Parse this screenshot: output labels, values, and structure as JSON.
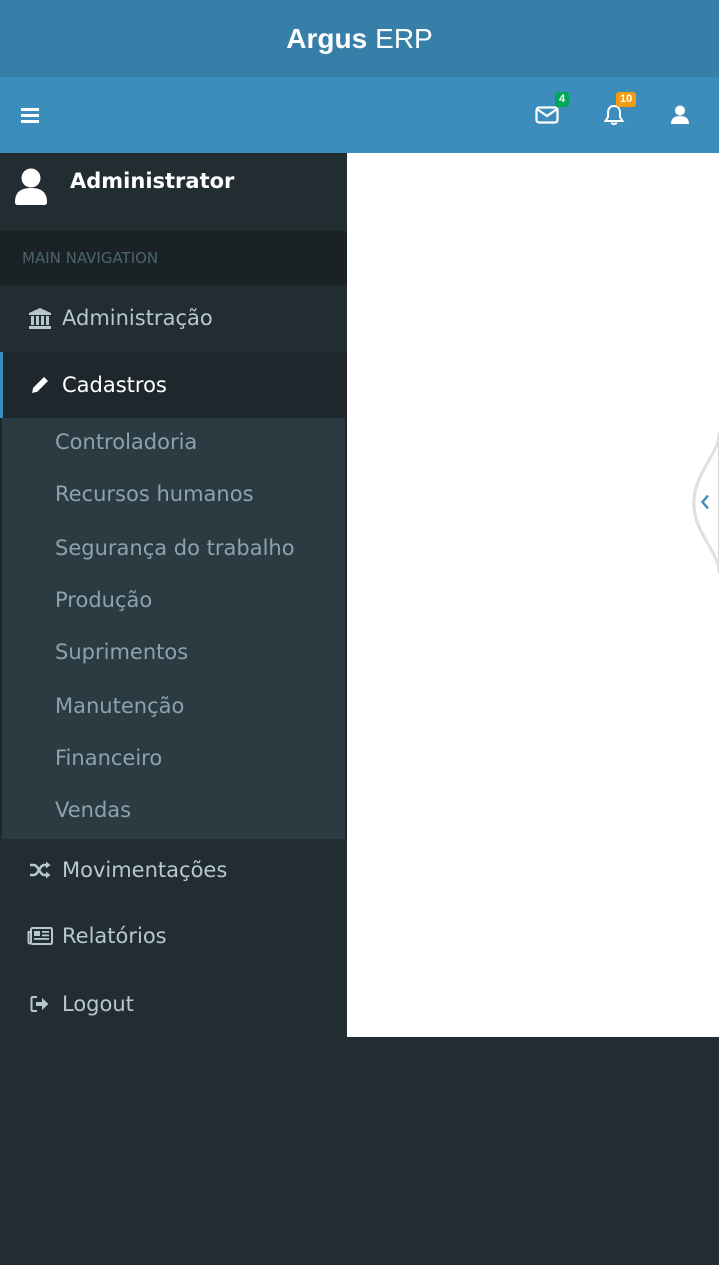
{
  "app": {
    "brand_bold": "Argus",
    "brand_light": "ERP"
  },
  "navbar": {
    "toggle_icon": "hamburger-icon",
    "messages": {
      "icon": "envelope-icon",
      "count": "4",
      "badge_color": "#00a65a"
    },
    "notifications": {
      "icon": "bell-icon",
      "count": "10",
      "badge_color": "#f39c12"
    },
    "user_icon": "user-icon"
  },
  "sidebar": {
    "user_name": "Administrator",
    "header": "MAIN NAVIGATION",
    "items": [
      {
        "label": "Administração",
        "icon": "bank-icon"
      },
      {
        "label": "Cadastros",
        "icon": "pencil-icon",
        "active": true
      },
      {
        "label": "Movimentações",
        "icon": "shuffle-icon"
      },
      {
        "label": "Relatórios",
        "icon": "newspaper-icon"
      },
      {
        "label": "Logout",
        "icon": "sign-out-icon"
      }
    ],
    "submenu": [
      "Controladoria",
      "Recursos humanos",
      "Segurança do trabalho",
      "Produção",
      "Suprimentos",
      "Manutenção",
      "Financeiro",
      "Vendas"
    ]
  },
  "colors": {
    "header": "#367fa9",
    "navbar": "#3c8dbc",
    "sidebar": "#222d32",
    "submenu": "#2c3b41"
  }
}
